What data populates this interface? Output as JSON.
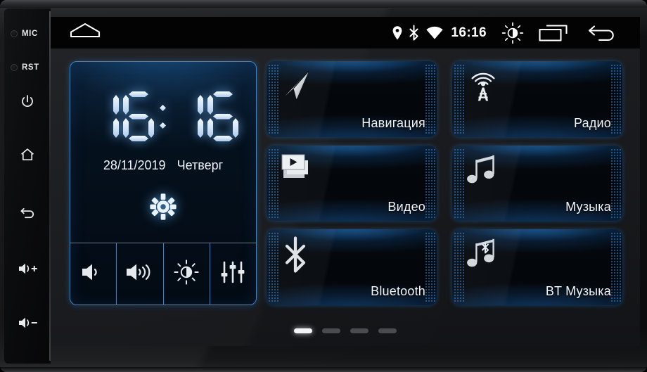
{
  "device": {
    "rail": {
      "indicators": [
        {
          "name": "mic",
          "label": "MIC"
        },
        {
          "name": "rst",
          "label": "RST"
        }
      ],
      "buttons": [
        {
          "name": "power",
          "icon": "power-icon"
        },
        {
          "name": "home",
          "icon": "home-icon"
        },
        {
          "name": "back",
          "icon": "back-icon"
        },
        {
          "name": "volume-up",
          "icon": "volume-up-icon",
          "label": "+"
        },
        {
          "name": "volume-down",
          "icon": "volume-down-icon",
          "label": "-"
        }
      ]
    }
  },
  "statusbar": {
    "home_icon": "home-icon",
    "time": "16:16",
    "icons": [
      {
        "name": "location-icon"
      },
      {
        "name": "bluetooth-icon"
      },
      {
        "name": "wifi-icon"
      }
    ],
    "right_icons": [
      {
        "name": "brightness-icon"
      },
      {
        "name": "recents-icon"
      },
      {
        "name": "back-icon"
      }
    ]
  },
  "clock_widget": {
    "time": "16:16",
    "time_digits": [
      "1",
      "6",
      "1",
      "6"
    ],
    "date": "28/11/2019",
    "weekday": "Четверг",
    "settings_icon": "gear-icon",
    "controls": [
      {
        "name": "volume-low",
        "icon": "volume-low-icon"
      },
      {
        "name": "volume-high",
        "icon": "volume-high-icon"
      },
      {
        "name": "brightness",
        "icon": "brightness-icon"
      },
      {
        "name": "equalizer",
        "icon": "equalizer-icon"
      }
    ]
  },
  "tiles": [
    {
      "id": "navigation",
      "label": "Навигация",
      "icon": "navigation-arrow-icon"
    },
    {
      "id": "radio",
      "label": "Радио",
      "icon": "radio-tower-icon"
    },
    {
      "id": "video",
      "label": "Видео",
      "icon": "video-icon"
    },
    {
      "id": "music",
      "label": "Музыка",
      "icon": "music-note-icon"
    },
    {
      "id": "bluetooth",
      "label": "Bluetooth",
      "icon": "bluetooth-icon"
    },
    {
      "id": "bt-music",
      "label": "BT Музыка",
      "icon": "bluetooth-music-icon"
    }
  ],
  "page_indicator": {
    "count": 4,
    "active_index": 0
  },
  "colors": {
    "accent_blue": "#2d87d8",
    "glow_blue": "#2476c4",
    "screen_bg": "#17181b",
    "statusbar_bg": "#030304",
    "text": "#f2f5f9",
    "digit": "#cfe2f7"
  }
}
